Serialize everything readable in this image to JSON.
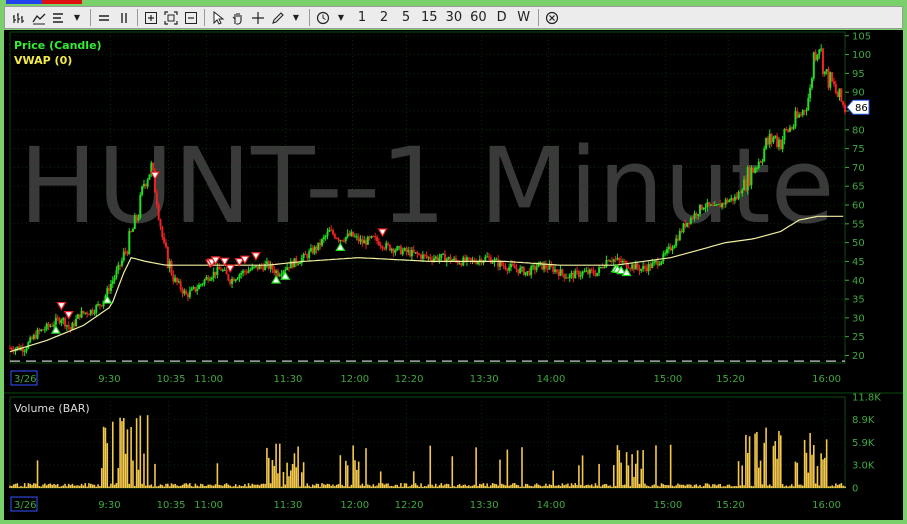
{
  "toolbar": {
    "buttons": [
      {
        "icon": "bar-chart-icon"
      },
      {
        "icon": "line-chart-icon"
      },
      {
        "icon": "indicator-list-icon"
      },
      {
        "icon": "dropdown-arrow-icon"
      },
      {
        "icon": "horizontal-split-icon"
      },
      {
        "icon": "vertical-split-icon"
      },
      {
        "icon": "zoom-in-icon"
      },
      {
        "icon": "fit-icon"
      },
      {
        "icon": "zoom-out-icon"
      },
      {
        "icon": "pointer-icon"
      },
      {
        "icon": "hand-pan-icon"
      },
      {
        "icon": "crosshair-icon"
      },
      {
        "icon": "pencil-draw-icon"
      },
      {
        "icon": "dropdown-arrow-icon"
      },
      {
        "icon": "clock-icon"
      },
      {
        "icon": "dropdown-arrow-icon"
      }
    ],
    "timeframes": [
      "1",
      "2",
      "5",
      "15",
      "30",
      "60",
      "D",
      "W"
    ],
    "close_icon": "circle-x-icon"
  },
  "colors": {
    "frame": "#7ad16b",
    "background": "#000000",
    "grid": "#0c4a0c",
    "axis_text": "#3fa83f",
    "up_candle": "#22dd22",
    "down_candle": "#ee2222",
    "vwap": "#f2f0a0",
    "volume": "#f4c84a",
    "title_label": "#33ee33",
    "vwap_label": "#f2e94a",
    "watermark": "#3a3a3a"
  },
  "chart_data": [
    {
      "type": "candlestick",
      "watermark": "HUNT--1 Minute",
      "series_labels": [
        "Price (Candle)",
        "VWAP (0)"
      ],
      "date_label": "3/26",
      "x_ticks": [
        "9:30",
        "10:35",
        "11:00",
        "11:30",
        "12:00",
        "12:20",
        "13:30",
        "14:00",
        "15:00",
        "15:20",
        "16:00"
      ],
      "y_ticks": [
        20,
        25,
        30,
        35,
        40,
        45,
        50,
        55,
        60,
        65,
        70,
        75,
        80,
        85,
        90,
        95,
        100,
        105
      ],
      "y_tick_labels": [
        "20",
        "25",
        "30",
        "35",
        "40",
        "45",
        "50",
        "55",
        "60",
        "65",
        "70",
        "75",
        "80",
        "85",
        "90",
        "95",
        "100",
        "105"
      ],
      "ylim": [
        18,
        106
      ],
      "last_price": "86",
      "reference_line": 18.5,
      "price_path": [
        [
          0,
          22
        ],
        [
          8,
          22
        ],
        [
          15,
          26
        ],
        [
          22,
          28
        ],
        [
          28,
          30
        ],
        [
          33,
          27
        ],
        [
          38,
          31
        ],
        [
          45,
          32
        ],
        [
          50,
          34
        ],
        [
          56,
          40
        ],
        [
          61,
          45
        ],
        [
          66,
          52
        ],
        [
          70,
          58
        ],
        [
          73,
          66
        ],
        [
          77,
          70
        ],
        [
          80,
          62
        ],
        [
          84,
          48
        ],
        [
          90,
          40
        ],
        [
          96,
          36
        ],
        [
          102,
          38
        ],
        [
          108,
          41
        ],
        [
          115,
          43
        ],
        [
          120,
          40
        ],
        [
          126,
          42
        ],
        [
          132,
          43
        ],
        [
          140,
          44
        ],
        [
          146,
          42
        ],
        [
          152,
          44
        ],
        [
          160,
          46
        ],
        [
          168,
          49
        ],
        [
          174,
          53
        ],
        [
          180,
          51
        ],
        [
          186,
          52
        ],
        [
          192,
          50
        ],
        [
          198,
          51
        ],
        [
          205,
          49
        ],
        [
          212,
          48
        ],
        [
          220,
          47
        ],
        [
          228,
          46
        ],
        [
          236,
          46
        ],
        [
          244,
          45
        ],
        [
          252,
          45
        ],
        [
          260,
          46
        ],
        [
          268,
          44
        ],
        [
          276,
          43
        ],
        [
          282,
          42
        ],
        [
          288,
          44
        ],
        [
          296,
          43
        ],
        [
          304,
          41
        ],
        [
          312,
          42
        ],
        [
          320,
          42
        ],
        [
          326,
          46
        ],
        [
          332,
          45
        ],
        [
          338,
          44
        ],
        [
          344,
          43
        ],
        [
          350,
          44
        ],
        [
          356,
          46
        ],
        [
          362,
          50
        ],
        [
          368,
          55
        ],
        [
          374,
          58
        ],
        [
          378,
          60
        ],
        [
          384,
          59
        ],
        [
          390,
          61
        ],
        [
          396,
          62
        ],
        [
          400,
          66
        ],
        [
          404,
          69
        ],
        [
          408,
          72
        ],
        [
          412,
          76
        ],
        [
          416,
          78
        ],
        [
          420,
          77
        ],
        [
          424,
          80
        ],
        [
          428,
          82
        ],
        [
          432,
          85
        ],
        [
          436,
          90
        ],
        [
          438,
          100
        ],
        [
          441,
          103
        ],
        [
          444,
          95
        ],
        [
          448,
          92
        ],
        [
          452,
          88
        ],
        [
          455,
          86
        ]
      ],
      "vwap_path": [
        [
          0,
          21
        ],
        [
          20,
          24
        ],
        [
          40,
          28
        ],
        [
          55,
          33
        ],
        [
          62,
          42
        ],
        [
          66,
          46
        ],
        [
          74,
          45
        ],
        [
          85,
          44
        ],
        [
          100,
          44
        ],
        [
          120,
          44
        ],
        [
          140,
          44
        ],
        [
          160,
          45
        ],
        [
          190,
          46
        ],
        [
          230,
          45
        ],
        [
          270,
          45
        ],
        [
          300,
          44
        ],
        [
          330,
          44
        ],
        [
          345,
          45
        ],
        [
          360,
          46
        ],
        [
          375,
          48
        ],
        [
          390,
          50
        ],
        [
          405,
          51
        ],
        [
          420,
          53
        ],
        [
          430,
          56
        ],
        [
          440,
          57
        ],
        [
          455,
          57
        ]
      ],
      "x_count": 456,
      "volume": {
        "label": "Volume (BAR)",
        "y_ticks": [
          0,
          3000,
          5900,
          8900,
          11800
        ],
        "y_tick_labels": [
          "0",
          "3.0K",
          "5.9K",
          "8.9K",
          "11.8K"
        ],
        "ylim": [
          0,
          11800
        ],
        "bursts": [
          [
            48,
            75,
            9500
          ],
          [
            78,
            80,
            7000
          ],
          [
            140,
            160,
            6000
          ],
          [
            180,
            190,
            5500
          ],
          [
            330,
            345,
            5000
          ],
          [
            400,
            420,
            8000
          ],
          [
            425,
            445,
            7800
          ]
        ],
        "baseline": 500
      }
    }
  ]
}
